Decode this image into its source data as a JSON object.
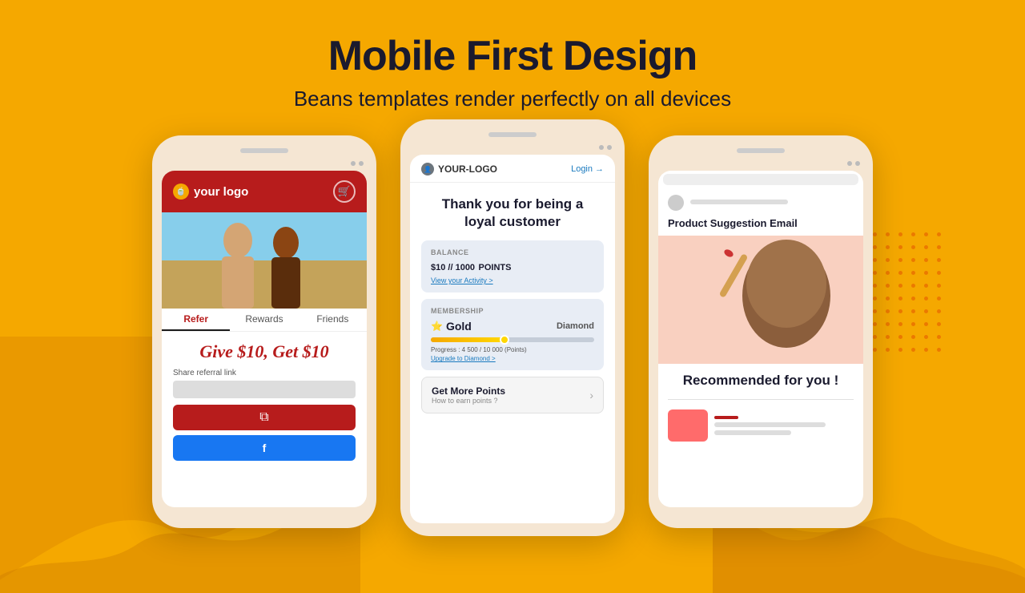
{
  "header": {
    "main_title": "Mobile First Design",
    "subtitle": "Beans templates render perfectly on all devices"
  },
  "phone1": {
    "logo_text": "your logo",
    "tabs": [
      "Refer",
      "Rewards",
      "Friends"
    ],
    "active_tab": "Refer",
    "give_text": "Give $10, Get $10",
    "share_label": "Share referral link"
  },
  "phone2": {
    "logo_text": "YOUR-LOGO",
    "login_text": "Login",
    "thank_you_text": "Thank you for being a loyal customer",
    "balance_label": "BALANCE",
    "balance_amount": "$10 // 1000",
    "balance_points": "POINTS",
    "view_activity": "View your Activity >",
    "membership_label": "MEMBERSHIP",
    "tier_current": "Gold",
    "tier_next": "Diamond",
    "progress_text": "Progress : 4 500 / 10 000 (Points)",
    "upgrade_link": "Upgrade to Diamond >",
    "points_title": "Get More Points",
    "points_sub": "How to earn points ?",
    "progress_percent": 45
  },
  "phone3": {
    "email_subject": "Product Suggestion Email",
    "recommended_text": "Recommended for you !",
    "avatar_color": "#cccccc"
  },
  "colors": {
    "background": "#F5A800",
    "phone_shell": "#f5e6d3",
    "primary_red": "#b71c1c",
    "primary_blue": "#1877F2",
    "dark_navy": "#1a1a2e",
    "gold": "#FFD700"
  }
}
